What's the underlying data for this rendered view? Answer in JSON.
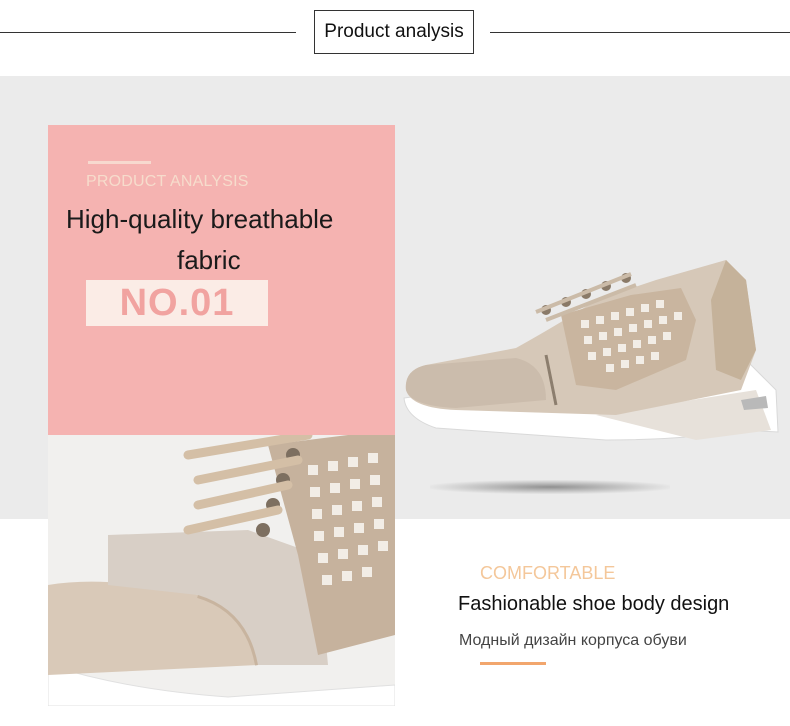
{
  "header": {
    "title": "Product analysis"
  },
  "feature1": {
    "section_label": "PRODUCT ANALYSIS",
    "title_line1": "High-quality breathable",
    "title_line2": "fabric",
    "number": "NO.01",
    "panel_color": "#f5b3b1"
  },
  "feature2": {
    "section_label": "COMFORTABLE",
    "title": "Fashionable shoe body design",
    "subtitle_ru": "Модный дизайн корпуса обуви",
    "accent_color": "#f2a66d"
  },
  "images": {
    "top_shoe": "gold-perforated-wedge-sneaker-side-view",
    "bottom_shoe": "gold-perforated-wedge-sneaker-closeup"
  }
}
